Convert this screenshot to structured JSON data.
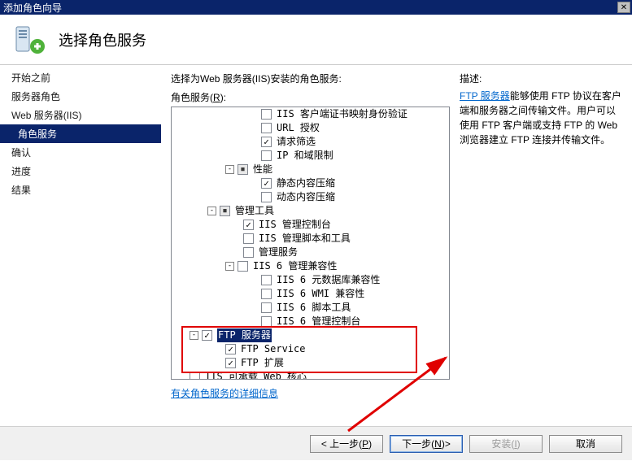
{
  "window": {
    "title": "添加角色向导"
  },
  "header": {
    "title": "选择角色服务"
  },
  "sidebar": {
    "items": [
      {
        "label": "开始之前",
        "sub": false
      },
      {
        "label": "服务器角色",
        "sub": false
      },
      {
        "label": "Web 服务器(IIS)",
        "sub": false
      },
      {
        "label": "角色服务",
        "sub": true,
        "selected": true
      },
      {
        "label": "确认",
        "sub": false
      },
      {
        "label": "进度",
        "sub": false
      },
      {
        "label": "结果",
        "sub": false
      }
    ]
  },
  "content": {
    "instruction": "选择为Web 服务器(IIS)安装的角色服务:",
    "roles_label_pre": "角色服务",
    "roles_label_mn": "R",
    "more_info_link": "有关角色服务的详细信息",
    "desc_label": "描述:",
    "desc_link": "FTP 服务器",
    "desc_text": "能够使用 FTP 协议在客户端和服务器之间传输文件。用户可以使用 FTP 客户端或支持 FTP 的 Web 浏览器建立 FTP 连接并传输文件。"
  },
  "tree": [
    {
      "depth": 4,
      "chk": "unchecked",
      "label": "IIS 客户端证书映射身份验证"
    },
    {
      "depth": 4,
      "chk": "unchecked",
      "label": "URL 授权"
    },
    {
      "depth": 4,
      "chk": "checked",
      "label": "请求筛选"
    },
    {
      "depth": 4,
      "chk": "unchecked",
      "label": "IP 和域限制"
    },
    {
      "depth": 2,
      "expander": "-",
      "chk": "mixed",
      "label": "性能"
    },
    {
      "depth": 4,
      "chk": "checked",
      "label": "静态内容压缩"
    },
    {
      "depth": 4,
      "chk": "unchecked",
      "label": "动态内容压缩"
    },
    {
      "depth": 1,
      "expander": "-",
      "chk": "mixed",
      "label": "管理工具"
    },
    {
      "depth": 3,
      "chk": "checked",
      "label": "IIS 管理控制台"
    },
    {
      "depth": 3,
      "chk": "unchecked",
      "label": "IIS 管理脚本和工具"
    },
    {
      "depth": 3,
      "chk": "unchecked",
      "label": "管理服务"
    },
    {
      "depth": 2,
      "expander": "-",
      "chk": "unchecked",
      "label": "IIS 6 管理兼容性"
    },
    {
      "depth": 4,
      "chk": "unchecked",
      "label": "IIS 6 元数据库兼容性"
    },
    {
      "depth": 4,
      "chk": "unchecked",
      "label": "IIS 6 WMI 兼容性"
    },
    {
      "depth": 4,
      "chk": "unchecked",
      "label": "IIS 6 脚本工具"
    },
    {
      "depth": 4,
      "chk": "unchecked",
      "label": "IIS 6 管理控制台"
    },
    {
      "depth": 0,
      "expander": "-",
      "chk": "checked",
      "label": "FTP 服务器",
      "highlight": true
    },
    {
      "depth": 2,
      "chk": "checked",
      "label": "FTP Service"
    },
    {
      "depth": 2,
      "chk": "checked",
      "label": "FTP 扩展"
    },
    {
      "depth": 0,
      "chk": "unchecked",
      "label": "IIS 可承载 Web 核心"
    }
  ],
  "buttons": {
    "prev_pre": "< 上一步",
    "prev_mn": "P",
    "next_pre": "下一步",
    "next_mn": "N",
    "next_post": " >",
    "install_pre": "安装",
    "install_mn": "I",
    "cancel": "取消"
  }
}
